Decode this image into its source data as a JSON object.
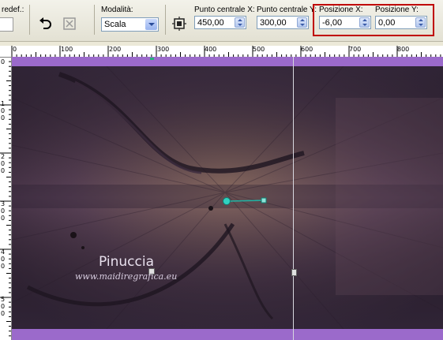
{
  "toolbar": {
    "preset_label": "redef.:",
    "mode_label": "Modalità:",
    "mode_value": "Scala",
    "center_x_label": "Punto centrale X:",
    "center_x_value": "450,00",
    "center_y_label": "Punto centrale Y:",
    "center_y_value": "300,00",
    "pos_x_label": "Posizione X:",
    "pos_x_value": "-6,00",
    "pos_y_label": "Posizione Y:",
    "pos_y_value": "0,00",
    "highlight_color": "#c00000"
  },
  "ruler": {
    "top_labels": [
      "0",
      "100",
      "200",
      "300",
      "400",
      "500",
      "600",
      "700",
      "800"
    ],
    "left_labels": [
      "0",
      "1\n0\n0",
      "2\n0\n0",
      "3\n0\n0",
      "4\n0\n0",
      "5\n0\n0"
    ]
  },
  "canvas": {
    "watermark_name": "Pinuccia",
    "watermark_url": "www.maidiregrafica.eu",
    "background_color": "#8e5fb8"
  },
  "icons": [
    "undo-icon",
    "flip-icon",
    "pick-tool-icon"
  ]
}
